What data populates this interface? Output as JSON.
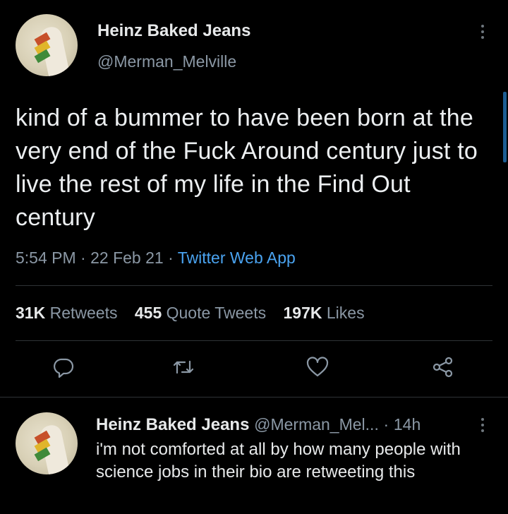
{
  "tweet": {
    "author_name": "Heinz Baked Jeans",
    "author_handle": "@Merman_Melville",
    "text": "kind of a bummer to have been born at the very end of the Fuck Around century just to live the rest of my life in the Find Out century",
    "time": "5:54 PM",
    "date": "22 Feb 21",
    "separator": "·",
    "source": "Twitter Web App",
    "stats": {
      "retweets_count": "31K",
      "retweets_label": "Retweets",
      "quotes_count": "455",
      "quotes_label": "Quote Tweets",
      "likes_count": "197K",
      "likes_label": "Likes"
    },
    "actions": [
      "reply-icon",
      "retweet-icon",
      "like-icon",
      "share-icon"
    ]
  },
  "reply": {
    "author_name": "Heinz Baked Jeans",
    "author_handle": "@Merman_Mel...",
    "separator": "·",
    "age": "14h",
    "text": "i'm not comforted at all by how many people with science jobs in their bio are retweeting this"
  },
  "colors": {
    "background": "#000000",
    "text": "#e7e9ea",
    "secondary": "#8b98a5",
    "link": "#4aa3f0",
    "divider": "#2f3336"
  }
}
